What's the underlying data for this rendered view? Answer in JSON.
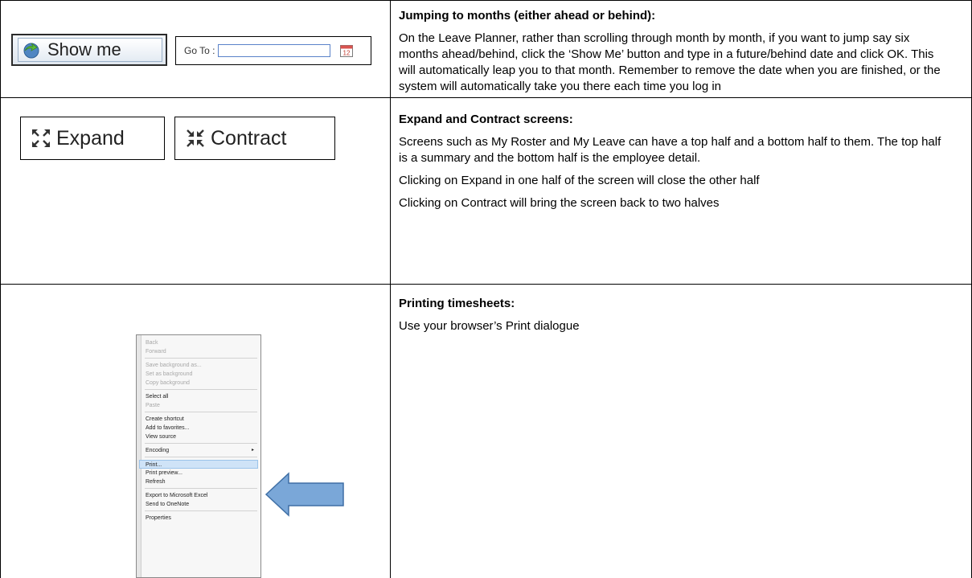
{
  "rows": [
    {
      "heading": "Jumping to months (either ahead or behind):",
      "paragraphs": [
        "On the Leave Planner, rather than scrolling through month by month, if you want to jump say six months ahead/behind, click the ‘Show Me’ button and type in a future/behind date and click OK. This will automatically leap you to that month. Remember to remove the date when you are finished, or the system will automatically take you there each time you log in"
      ]
    },
    {
      "heading": "Expand and Contract screens:",
      "paragraphs": [
        "Screens such as My Roster and My Leave can have a top half and a bottom half to them. The top half is a summary and the bottom half is the employee detail.",
        "Clicking on Expand in one half of the screen will close the other half",
        "Clicking on Contract will bring the screen back to two halves"
      ]
    },
    {
      "heading": "Printing timesheets:",
      "paragraphs": [
        "Use your browser’s Print dialogue"
      ]
    }
  ],
  "widgets": {
    "show_me_label": "Show me",
    "goto_label": "Go To :",
    "calendar_day": "12",
    "expand_label": "Expand",
    "contract_label": "Contract"
  },
  "context_menu": {
    "items": [
      {
        "label": "Back",
        "disabled": true
      },
      {
        "label": "Forward",
        "disabled": true
      },
      {
        "sep": true
      },
      {
        "label": "Save background as...",
        "disabled": true
      },
      {
        "label": "Set as background",
        "disabled": true
      },
      {
        "label": "Copy background",
        "disabled": true
      },
      {
        "sep": true
      },
      {
        "label": "Select all",
        "disabled": false
      },
      {
        "label": "Paste",
        "disabled": true
      },
      {
        "sep": true
      },
      {
        "label": "Create shortcut",
        "disabled": false
      },
      {
        "label": "Add to favorites...",
        "disabled": false
      },
      {
        "label": "View source",
        "disabled": false
      },
      {
        "sep": true
      },
      {
        "label": "Encoding",
        "disabled": false,
        "submenu": true
      },
      {
        "sep": true
      },
      {
        "label": "Print...",
        "disabled": false,
        "active": true
      },
      {
        "label": "Print preview...",
        "disabled": false
      },
      {
        "label": "Refresh",
        "disabled": false
      },
      {
        "sep": true
      },
      {
        "label": "Export to Microsoft Excel",
        "disabled": false
      },
      {
        "label": "Send to OneNote",
        "disabled": false
      },
      {
        "sep": true
      },
      {
        "label": "Properties",
        "disabled": false
      }
    ]
  },
  "colors": {
    "arrow_fill": "#7aa7d8",
    "arrow_stroke": "#3f6fa5",
    "menu_highlight": "#cfe3f7"
  },
  "icons": {
    "show_me": "refresh-globe-icon",
    "calendar": "calendar-icon",
    "expand": "expand-arrows-icon",
    "contract": "contract-arrows-icon",
    "pointer": "left-arrow-pointer-icon"
  }
}
